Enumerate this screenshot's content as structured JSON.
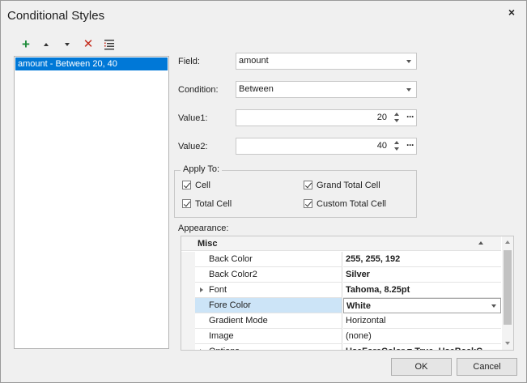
{
  "window": {
    "title": "Conditional Styles",
    "close_glyph": "×"
  },
  "toolbar": {
    "buttons": [
      {
        "icon": "add-icon",
        "glyph": "+"
      },
      {
        "icon": "move-up-icon",
        "glyph": "▲"
      },
      {
        "icon": "move-down-icon",
        "glyph": "▼"
      },
      {
        "icon": "delete-icon",
        "glyph": "✕"
      },
      {
        "icon": "properties-icon",
        "glyph": "☰"
      }
    ]
  },
  "rules_list": {
    "items": [
      "amount - Between 20, 40"
    ]
  },
  "form": {
    "field_label": "Field:",
    "field_value": "amount",
    "condition_label": "Condition:",
    "condition_value": "Between",
    "value1_label": "Value1:",
    "value1": "20",
    "value2_label": "Value2:",
    "value2": "40",
    "ellipsis": "···"
  },
  "apply_to": {
    "title": "Apply To:",
    "cell": "Cell",
    "grand_total_cell": "Grand Total Cell",
    "total_cell": "Total Cell",
    "custom_total_cell": "Custom Total Cell"
  },
  "appearance": {
    "title": "Appearance:",
    "category": "Misc",
    "rows": [
      {
        "name": "Back Color",
        "value": "255, 255, 192"
      },
      {
        "name": "Back Color2",
        "value": "Silver"
      },
      {
        "name": "Font",
        "value": "Tahoma, 8.25pt"
      },
      {
        "name": "Fore Color",
        "value": "White"
      },
      {
        "name": "Gradient Mode",
        "value": "Horizontal"
      },
      {
        "name": "Image",
        "value": "(none)"
      },
      {
        "name": "Options",
        "value": "UseForeColor = True, UseBackC"
      }
    ]
  },
  "buttons": {
    "ok": "OK",
    "cancel": "Cancel"
  },
  "colors": {
    "accent": "#0078d7",
    "selected_row": "#cce4f7",
    "add_icon": "#1e8c3a",
    "delete_icon": "#c42b1c"
  }
}
